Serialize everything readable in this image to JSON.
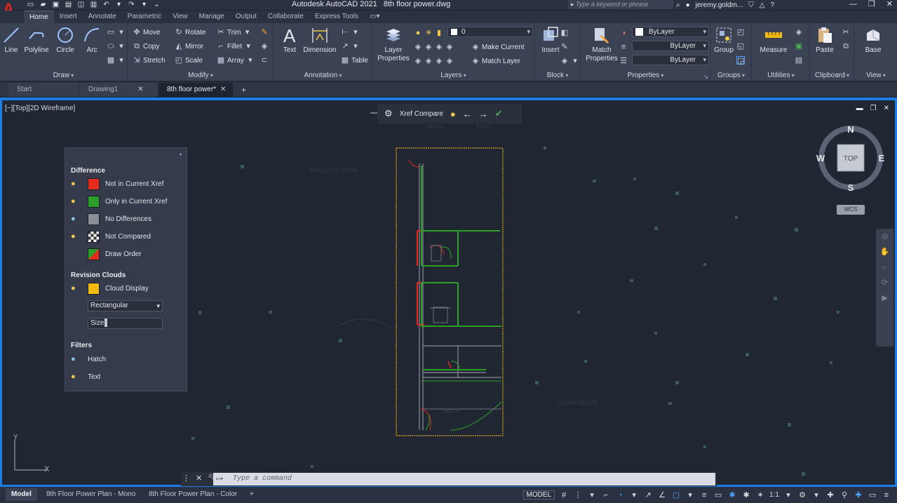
{
  "app": {
    "logo": "A",
    "title": "Autodesk AutoCAD 2021",
    "document": "8th floor power.dwg",
    "search_placeholder": "Type a keyword or phrase",
    "user": "jeremy.goldm...",
    "help": "?"
  },
  "ribbon_tabs": [
    "Home",
    "Insert",
    "Annotate",
    "Parametric",
    "View",
    "Manage",
    "Output",
    "Collaborate",
    "Express Tools",
    "▭▾"
  ],
  "ribbon": {
    "draw": {
      "title": "Draw",
      "line": "Line",
      "polyline": "Polyline",
      "circle": "Circle",
      "arc": "Arc"
    },
    "modify": {
      "title": "Modify",
      "move": "Move",
      "rotate": "Rotate",
      "trim": "Trim",
      "copy": "Copy",
      "mirror": "Mirror",
      "fillet": "Fillet",
      "stretch": "Stretch",
      "scale": "Scale",
      "array": "Array"
    },
    "annotation": {
      "title": "Annotation",
      "text": "Text",
      "dimension": "Dimension",
      "table": "Table"
    },
    "layers": {
      "title": "Layers",
      "layer_properties_1": "Layer",
      "layer_properties_2": "Properties",
      "current_layer": "0",
      "make_current": "Make Current",
      "match_layer": "Match Layer"
    },
    "block": {
      "title": "Block",
      "insert": "Insert"
    },
    "properties": {
      "title": "Properties",
      "match_1": "Match",
      "match_2": "Properties",
      "color": "ByLayer",
      "linetype": "ByLayer",
      "lineweight": "ByLayer"
    },
    "groups": {
      "title": "Groups",
      "group": "Group"
    },
    "utilities": {
      "title": "Utilities",
      "measure": "Measure"
    },
    "clipboard": {
      "title": "Clipboard",
      "paste": "Paste"
    },
    "view": {
      "title": "View",
      "base": "Base"
    }
  },
  "doc_tabs": [
    {
      "label": "Start"
    },
    {
      "label": "Drawing1",
      "close": "✕"
    },
    {
      "label": "8th floor power*",
      "close": "✕"
    }
  ],
  "doc_tab_add": "+",
  "viewport": {
    "label": "[−][Top][2D Wireframe]",
    "controls": [
      "▬",
      "❐",
      "✕"
    ]
  },
  "xref_toolbar": {
    "label": "Xref Compare"
  },
  "xref_panel": {
    "difference_title": "Difference",
    "rows": [
      {
        "label": "Not in Current Xref",
        "color": "#e52b1e"
      },
      {
        "label": "Only in Current Xref",
        "color": "#2aa02a"
      },
      {
        "label": "No Differences",
        "color": "#8a8f97"
      },
      {
        "label": "Not Compared",
        "color": "checker"
      },
      {
        "label": "Draw Order",
        "color": "draworder"
      }
    ],
    "revision_title": "Revision Clouds",
    "cloud_display": {
      "label": "Cloud Display",
      "color": "#f2b90f"
    },
    "shape": "Rectangular",
    "size": "Size",
    "filters_title": "Filters",
    "filters": [
      "Hatch",
      "Text"
    ]
  },
  "viewcube": {
    "n": "N",
    "s": "S",
    "e": "E",
    "w": "W",
    "face": "TOP",
    "wcs": "WCS"
  },
  "ucs": {
    "x": "X",
    "y": "Y"
  },
  "command": {
    "placeholder": "Type a command"
  },
  "layout_tabs": [
    "Model",
    "8th Floor Power Plan - Mono",
    "8th Floor Power Plan - Color"
  ],
  "layout_add": "+",
  "status": {
    "model": "MODEL",
    "scale": "1:1"
  },
  "colors": {
    "accent": "#1a7ee6",
    "red": "#e52b1e",
    "green": "#2aa02a",
    "gold": "#d9a31a"
  }
}
